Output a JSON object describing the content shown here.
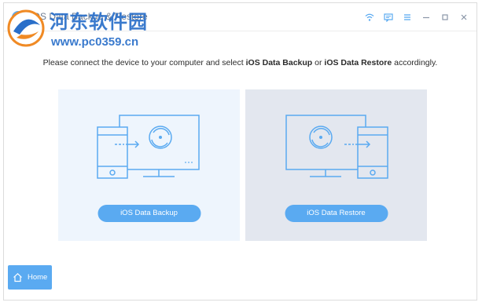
{
  "titlebar": {
    "app_title": "iOS Data Backup & Restore",
    "icons": [
      "wifi-icon",
      "feedback-icon",
      "menu-icon",
      "minimize-icon",
      "maximize-icon",
      "close-icon"
    ]
  },
  "watermark": {
    "site": "河东软件园",
    "url": "www.pc0359.cn"
  },
  "main": {
    "instruction_pre": "Please connect the device to your computer and select ",
    "instruction_opt1": "iOS Data Backup",
    "instruction_mid": " or ",
    "instruction_opt2": "iOS Data Restore",
    "instruction_post": " accordingly."
  },
  "options": {
    "backup_label": "iOS Data Backup",
    "restore_label": "iOS Data Restore"
  },
  "footer": {
    "home_label": "Home"
  },
  "colors": {
    "accent": "#5aaaf1",
    "line": "#5aaaf1",
    "backup_panel": "#eef5fd",
    "restore_panel": "#e3e7ef"
  }
}
